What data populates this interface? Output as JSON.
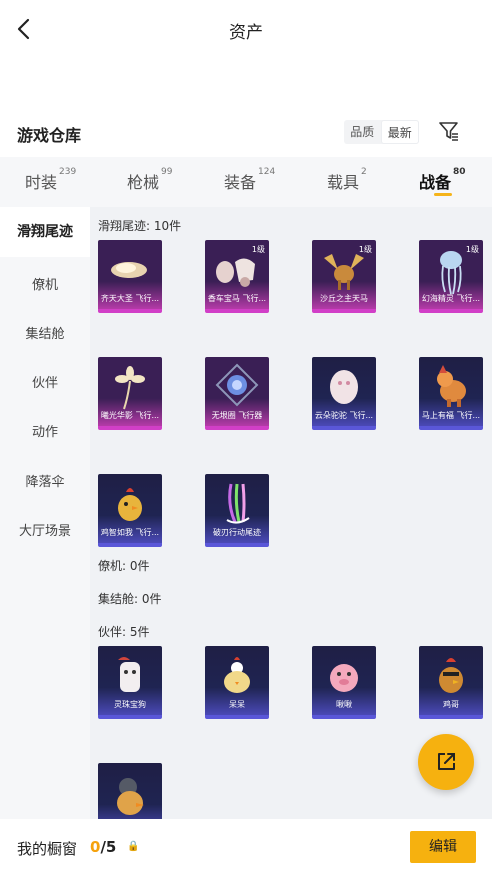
{
  "header": {
    "title": "资产"
  },
  "warehouse": {
    "title": "游戏仓库",
    "sort_options": [
      "品质",
      "最新"
    ],
    "sort_selected": "最新"
  },
  "tabs": [
    {
      "label": "时装",
      "count": "239"
    },
    {
      "label": "枪械",
      "count": "99"
    },
    {
      "label": "装备",
      "count": "124"
    },
    {
      "label": "载具",
      "count": "2"
    },
    {
      "label": "战备",
      "count": "80"
    }
  ],
  "sidebar": [
    {
      "label": "滑翔尾迹"
    },
    {
      "label": "僚机"
    },
    {
      "label": "集结舱"
    },
    {
      "label": "伙伴"
    },
    {
      "label": "动作"
    },
    {
      "label": "降落伞"
    },
    {
      "label": "大厅场景"
    }
  ],
  "sections": {
    "glide": {
      "heading": "滑翔尾迹: 10件",
      "items": [
        {
          "name": "齐天大圣 飞行...",
          "level": "",
          "rarity": "pink",
          "icon": "cloud-icon"
        },
        {
          "name": "香车宝马 飞行...",
          "level": "1级",
          "rarity": "pink",
          "icon": "carriage-icon"
        },
        {
          "name": "沙丘之主天马",
          "level": "1级",
          "rarity": "pink",
          "icon": "pegasus-icon"
        },
        {
          "name": "幻海精灵 飞行...",
          "level": "1级",
          "rarity": "pink",
          "icon": "jellyfish-icon"
        },
        {
          "name": "曦光华影 飞行...",
          "level": "",
          "rarity": "pink",
          "icon": "flower-icon"
        },
        {
          "name": "无垠圈 飞行器",
          "level": "",
          "rarity": "pink",
          "icon": "portal-icon"
        },
        {
          "name": "云朵驼驼 飞行...",
          "level": "",
          "rarity": "blue",
          "icon": "alpaca-icon"
        },
        {
          "name": "马上有福 飞行...",
          "level": "",
          "rarity": "blue",
          "icon": "horse-icon"
        },
        {
          "name": "鸡智如我 飞行...",
          "level": "",
          "rarity": "blue",
          "icon": "chicken-icon"
        },
        {
          "name": "破刃行动尾迹",
          "level": "",
          "rarity": "blue",
          "icon": "trail-icon"
        }
      ]
    },
    "wingman": {
      "heading": "僚机: 0件"
    },
    "pod": {
      "heading": "集结舱: 0件"
    },
    "partner": {
      "heading": "伙伴: 5件",
      "items": [
        {
          "name": "灵珠宝狗",
          "rarity": "blue",
          "icon": "dog-icon"
        },
        {
          "name": "呆呆",
          "rarity": "blue",
          "icon": "chick-icon"
        },
        {
          "name": "啾啾",
          "rarity": "blue",
          "icon": "pig-icon"
        },
        {
          "name": "鸡哥",
          "rarity": "blue",
          "icon": "rooster-icon"
        },
        {
          "name": "",
          "rarity": "blue",
          "icon": "duck-knight-icon"
        }
      ]
    }
  },
  "showcase": {
    "label": "我的橱窗",
    "current": "0",
    "total": "/5",
    "edit_label": "编辑"
  },
  "colors": {
    "accent": "#f6b10f",
    "pink_rarity": "#d13fc7",
    "blue_rarity": "#5a57d8"
  }
}
